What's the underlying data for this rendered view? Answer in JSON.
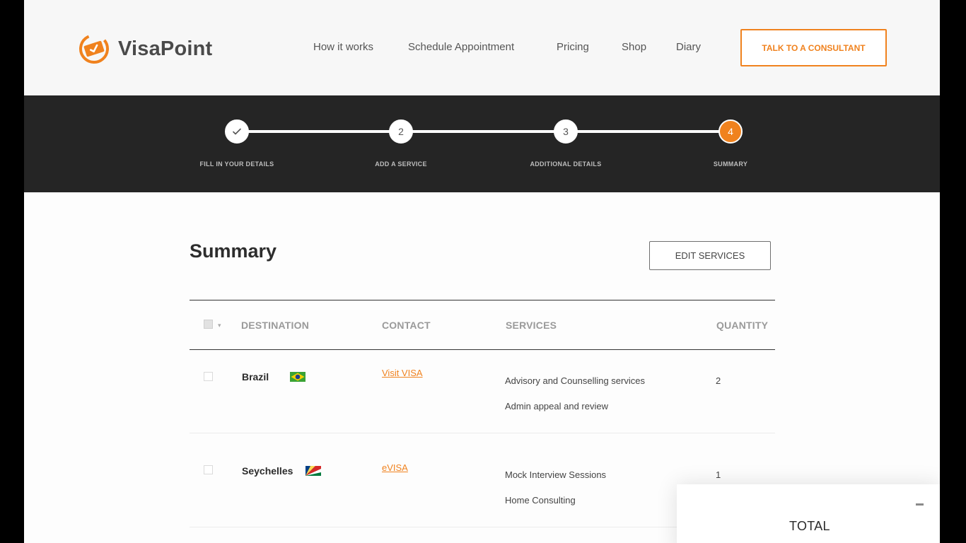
{
  "brand": {
    "name": "VisaPoint",
    "accent": "#f0821e"
  },
  "nav": {
    "items": [
      {
        "label": "How it works"
      },
      {
        "label": "Schedule Appointment"
      },
      {
        "label": "Pricing"
      },
      {
        "label": "Shop"
      },
      {
        "label": "Diary"
      }
    ],
    "cta_label": "TALK TO A CONSULTANT"
  },
  "stepper": {
    "current_step": 4,
    "steps": [
      {
        "number": "",
        "label": "FILL IN YOUR DETAILS",
        "state": "completed",
        "icon": "check-icon"
      },
      {
        "number": "2",
        "label": "ADD A SERVICE",
        "state": "pending"
      },
      {
        "number": "3",
        "label": "ADDITIONAL DETAILS",
        "state": "pending"
      },
      {
        "number": "4",
        "label": "SUMMARY",
        "state": "active"
      }
    ]
  },
  "summary": {
    "title": "Summary",
    "edit_label": "EDIT SERVICES",
    "columns": {
      "destination": "DESTINATION",
      "contact": "CONTACT",
      "services": "SERVICES",
      "quantity": "QUANTITY"
    },
    "rows": [
      {
        "destination": "Brazil",
        "flag_icon": "brazil-flag-icon",
        "contact": "Visit VISA",
        "services": [
          "Advisory and Counselling services",
          "Admin appeal and review"
        ],
        "quantity": "2"
      },
      {
        "destination": "Seychelles",
        "flag_icon": "seychelles-flag-icon",
        "contact": "eVISA",
        "services": [
          "Mock Interview Sessions",
          "Home Consulting"
        ],
        "quantity": "1"
      }
    ]
  },
  "total": {
    "label": "TOTAL"
  }
}
